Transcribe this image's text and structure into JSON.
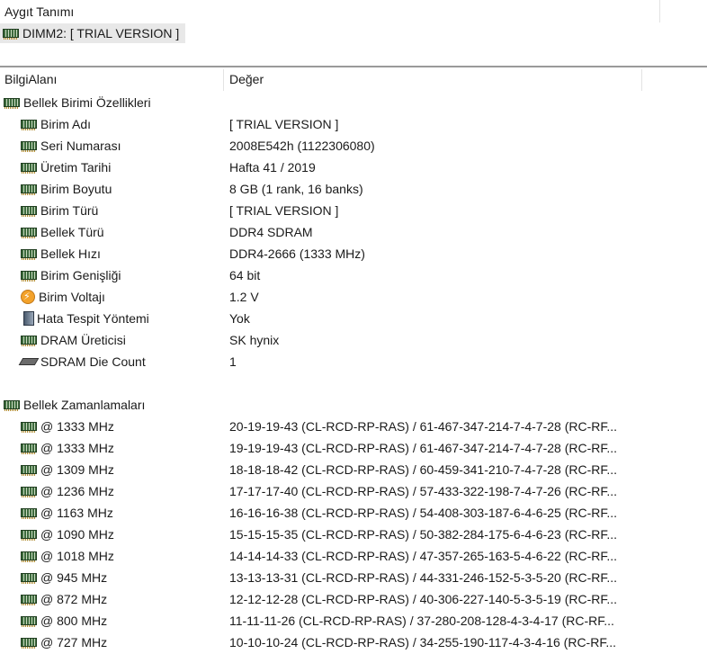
{
  "device_pane": {
    "header": "Aygıt Tanımı",
    "selected_device": "DIMM2: [ TRIAL VERSION ]",
    "device_icon": "ram-icon"
  },
  "columns": {
    "field": "BilgiAlanı",
    "value": "Değer"
  },
  "sections": [
    {
      "title": "Bellek Birimi Özellikleri",
      "icon": "ram-icon",
      "items": [
        {
          "name": "Birim Adı",
          "value": "[ TRIAL VERSION ]",
          "icon": "ram-icon"
        },
        {
          "name": "Seri Numarası",
          "value": "2008E542h (1122306080)",
          "icon": "ram-icon"
        },
        {
          "name": "Üretim Tarihi",
          "value": "Hafta 41 / 2019",
          "icon": "ram-icon"
        },
        {
          "name": "Birim Boyutu",
          "value": "8 GB (1 rank, 16 banks)",
          "icon": "ram-icon"
        },
        {
          "name": "Birim Türü",
          "value": "[ TRIAL VERSION ]",
          "icon": "ram-icon"
        },
        {
          "name": "Bellek Türü",
          "value": "DDR4 SDRAM",
          "icon": "ram-icon"
        },
        {
          "name": "Bellek Hızı",
          "value": "DDR4-2666 (1333 MHz)",
          "icon": "ram-icon"
        },
        {
          "name": "Birim Genişliği",
          "value": "64 bit",
          "icon": "ram-icon"
        },
        {
          "name": "Birim Voltajı",
          "value": "1.2 V",
          "icon": "voltage-icon"
        },
        {
          "name": "Hata Tespit Yöntemi",
          "value": "Yok",
          "icon": "error-detection-icon"
        },
        {
          "name": "DRAM Üreticisi",
          "value": "SK hynix",
          "icon": "ram-icon"
        },
        {
          "name": "SDRAM Die Count",
          "value": "1",
          "icon": "chip-icon"
        }
      ]
    },
    {
      "title": "Bellek Zamanlamaları",
      "icon": "ram-icon",
      "items": [
        {
          "name": "@ 1333 MHz",
          "value": "20-19-19-43  (CL-RCD-RP-RAS) / 61-467-347-214-7-4-7-28  (RC-RF...",
          "icon": "ram-icon"
        },
        {
          "name": "@ 1333 MHz",
          "value": "19-19-19-43  (CL-RCD-RP-RAS) / 61-467-347-214-7-4-7-28  (RC-RF...",
          "icon": "ram-icon"
        },
        {
          "name": "@ 1309 MHz",
          "value": "18-18-18-42  (CL-RCD-RP-RAS) / 60-459-341-210-7-4-7-28  (RC-RF...",
          "icon": "ram-icon"
        },
        {
          "name": "@ 1236 MHz",
          "value": "17-17-17-40  (CL-RCD-RP-RAS) / 57-433-322-198-7-4-7-26  (RC-RF...",
          "icon": "ram-icon"
        },
        {
          "name": "@ 1163 MHz",
          "value": "16-16-16-38  (CL-RCD-RP-RAS) / 54-408-303-187-6-4-6-25  (RC-RF...",
          "icon": "ram-icon"
        },
        {
          "name": "@ 1090 MHz",
          "value": "15-15-15-35  (CL-RCD-RP-RAS) / 50-382-284-175-6-4-6-23  (RC-RF...",
          "icon": "ram-icon"
        },
        {
          "name": "@ 1018 MHz",
          "value": "14-14-14-33  (CL-RCD-RP-RAS) / 47-357-265-163-5-4-6-22  (RC-RF...",
          "icon": "ram-icon"
        },
        {
          "name": "@ 945 MHz",
          "value": "13-13-13-31  (CL-RCD-RP-RAS) / 44-331-246-152-5-3-5-20  (RC-RF...",
          "icon": "ram-icon"
        },
        {
          "name": "@ 872 MHz",
          "value": "12-12-12-28  (CL-RCD-RP-RAS) / 40-306-227-140-5-3-5-19  (RC-RF...",
          "icon": "ram-icon"
        },
        {
          "name": "@ 800 MHz",
          "value": "11-11-11-26  (CL-RCD-RP-RAS) / 37-280-208-128-4-3-4-17  (RC-RF...",
          "icon": "ram-icon"
        },
        {
          "name": "@ 727 MHz",
          "value": "10-10-10-24  (CL-RCD-RP-RAS) / 34-255-190-117-4-3-4-16  (RC-RF...",
          "icon": "ram-icon"
        }
      ]
    }
  ]
}
